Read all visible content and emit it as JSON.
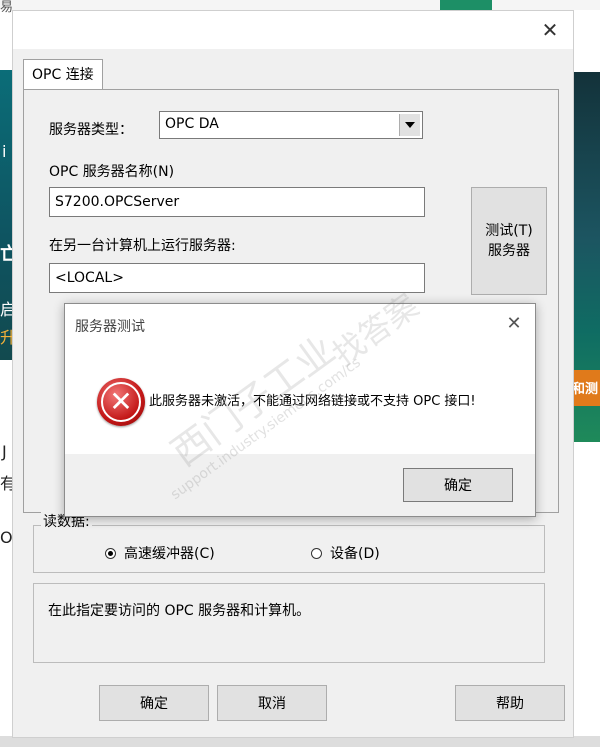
{
  "background": {
    "left_fragments": [
      "易",
      "亡",
      "启",
      "升",
      "i",
      "J",
      "有",
      "O"
    ],
    "right_fragment": "和测"
  },
  "dialog": {
    "close_glyph": "✕",
    "tab_label": "OPC 连接",
    "server_type_label": "服务器类型：",
    "server_type_value": "OPC DA",
    "server_name_label": "OPC 服务器名称(N)",
    "server_name_value": "S7200.OPCServer",
    "remote_label": "在另一台计算机上运行服务器:",
    "remote_value": "<LOCAL>",
    "test_button_line1": "测试(T)",
    "test_button_line2": "服务器",
    "read_group_title": "读数据:",
    "radio_cache_label": "高速缓冲器(C)",
    "radio_device_label": "设备(D)",
    "description": "在此指定要访问的 OPC 服务器和计算机。",
    "ok_label": "确定",
    "cancel_label": "取消",
    "help_label": "帮助"
  },
  "modal": {
    "title": "服务器测试",
    "close_glyph": "✕",
    "message": "此服务器未激活，不能通过网络链接或不支持 OPC 接口!",
    "ok_label": "确定"
  },
  "watermark": {
    "brand": "西门子工业",
    "tagline": "找答案",
    "url": "support.industry.siemens.com/cs"
  },
  "colors": {
    "dialog_bg": "#f0f0f0",
    "button_bg": "#e1e1e1",
    "error_red": "#c21616"
  }
}
